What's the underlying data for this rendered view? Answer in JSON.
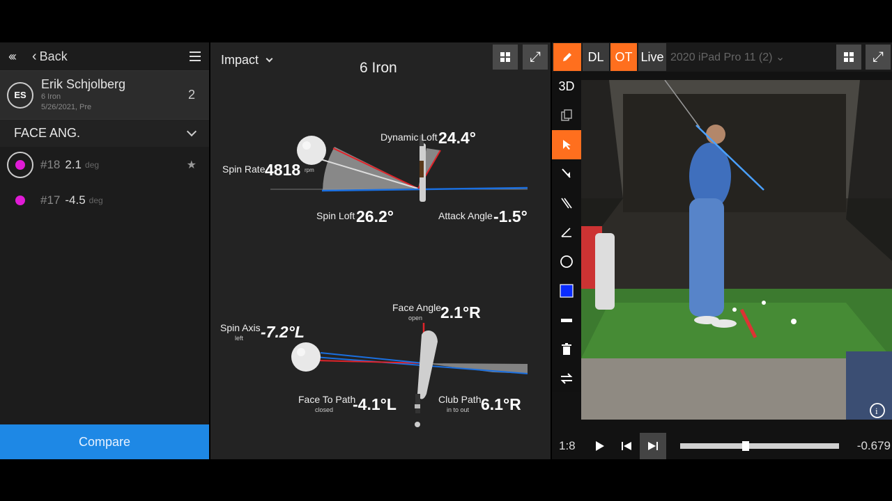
{
  "left": {
    "back_label": "Back",
    "player": {
      "initials": "ES",
      "name": "Erik Schjolberg",
      "club": "6 Iron",
      "date": "5/26/2021, Pre",
      "count": "2"
    },
    "parameter": "FACE ANG.",
    "shots": [
      {
        "number": "#18",
        "value": "2.1",
        "unit": "deg",
        "color": "#e01bd6"
      },
      {
        "number": "#17",
        "value": "-4.5",
        "unit": "deg",
        "color": "#e01bd6"
      }
    ],
    "compare_label": "Compare"
  },
  "middle": {
    "view": "Impact",
    "club": "6 Iron",
    "metrics": {
      "dynamic_loft": {
        "label": "Dynamic Loft",
        "value": "24.4°"
      },
      "spin_rate": {
        "label": "Spin Rate",
        "value": "4818",
        "unit": "rpm"
      },
      "spin_loft": {
        "label": "Spin Loft",
        "value": "26.2°"
      },
      "attack_angle": {
        "label": "Attack Angle",
        "value": "-1.5°"
      },
      "face_angle": {
        "label": "Face Angle",
        "sub": "open",
        "value": "2.1°R"
      },
      "spin_axis": {
        "label": "Spin Axis",
        "sub": "left",
        "value": "-7.2°L"
      },
      "face_to_path": {
        "label": "Face To Path",
        "sub": "closed",
        "value": "-4.1°L"
      },
      "club_path": {
        "label": "Club Path",
        "sub": "in to out",
        "value": "6.1°R"
      }
    }
  },
  "right": {
    "mode_dl": "DL",
    "mode_ot": "OT",
    "mode_live": "Live",
    "device": "2020 iPad Pro 11 (2)",
    "tool_3d": "3D",
    "playback_rate": "1:8",
    "time": "-0.679",
    "progress": 0.41
  },
  "colors": {
    "accent": "#ff6f1e",
    "compare": "#1e88e5",
    "shot": "#e01bd6",
    "path_blue": "#1a6fe0",
    "face_red": "#e0242a"
  }
}
